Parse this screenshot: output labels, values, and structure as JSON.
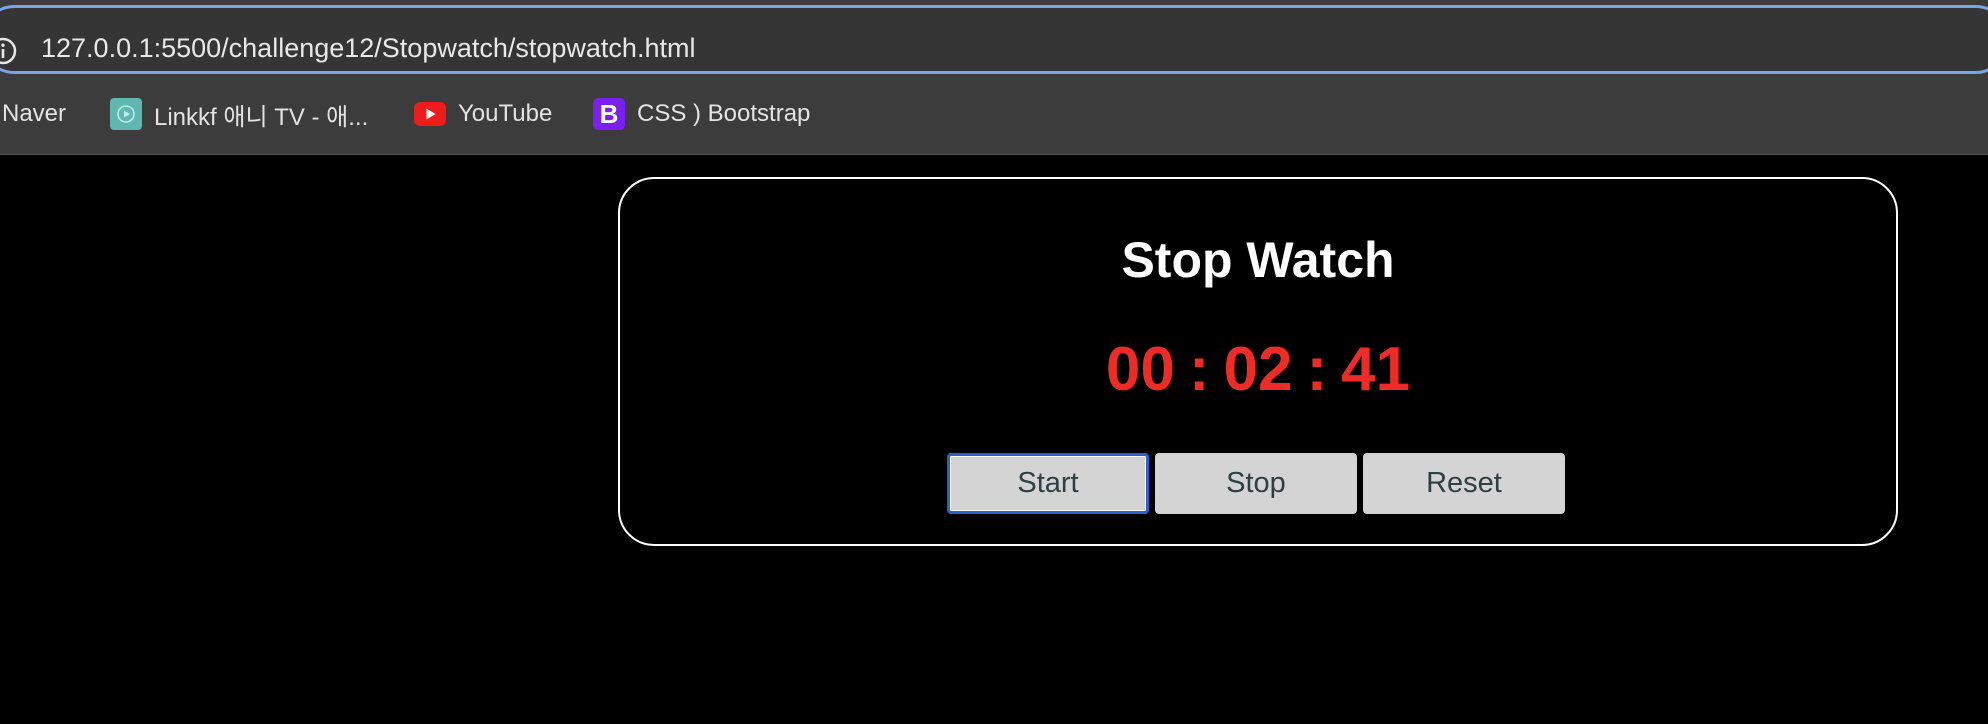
{
  "browser": {
    "url": "127.0.0.1:5500/challenge12/Stopwatch/stopwatch.html",
    "bookmarks": [
      {
        "label": "Naver",
        "icon": "none"
      },
      {
        "label": "Linkkf 애니 TV - 애...",
        "icon": "linkkf-play-icon"
      },
      {
        "label": "YouTube",
        "icon": "youtube-icon"
      },
      {
        "label": "CSS ) Bootstrap",
        "icon": "bootstrap-icon"
      }
    ],
    "bootstrap_icon_letter": "B"
  },
  "stopwatch": {
    "title": "Stop Watch",
    "hours": "00",
    "minutes": "02",
    "seconds": "41",
    "separator": ":",
    "buttons": {
      "start": "Start",
      "stop": "Stop",
      "reset": "Reset"
    }
  },
  "colors": {
    "background": "#000000",
    "time": "#ee2b24",
    "title": "#ffffff",
    "button_bg": "#d4d4d4",
    "button_text": "#2e4043",
    "focus_ring": "#2f5fcf",
    "address_focus": "#7da2e8"
  }
}
